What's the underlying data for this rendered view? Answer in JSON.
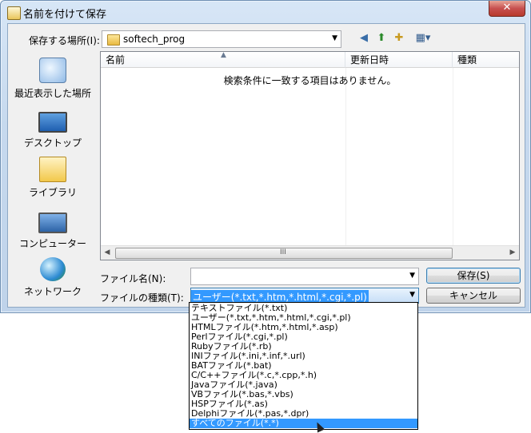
{
  "window": {
    "title": "名前を付けて保存",
    "close_label": "✕"
  },
  "toolbar": {
    "lookin_label": "保存する場所(I):",
    "lookin_value": "softech_prog",
    "back_icon": "back-icon",
    "up_icon": "up-folder-icon",
    "newfolder_icon": "new-folder-icon",
    "views_icon": "views-menu-icon"
  },
  "places": [
    {
      "label": "最近表示した場所",
      "icon": "recent-places-icon"
    },
    {
      "label": "デスクトップ",
      "icon": "desktop-icon"
    },
    {
      "label": "ライブラリ",
      "icon": "libraries-icon"
    },
    {
      "label": "コンピューター",
      "icon": "computer-icon"
    },
    {
      "label": "ネットワーク",
      "icon": "network-icon"
    }
  ],
  "filelist": {
    "columns": [
      "名前",
      "更新日時",
      "種類"
    ],
    "empty_message": "検索条件に一致する項目はありません。",
    "scroll_grip": "III"
  },
  "form": {
    "filename_label": "ファイル名(N):",
    "filename_value": "",
    "filetype_label": "ファイルの種類(T):",
    "filetype_value": "ユーザー(*.txt,*.htm,*.html,*.cgi,*.pl)",
    "save_label": "保存(S)",
    "cancel_label": "キャンセル"
  },
  "dropdown": {
    "options": [
      "テキストファイル(*.txt)",
      "ユーザー(*.txt,*.htm,*.html,*.cgi,*.pl)",
      "HTMLファイル(*.htm,*.html,*.asp)",
      "Perlファイル(*.cgi,*.pl)",
      "Rubyファイル(*.rb)",
      "INIファイル(*.ini,*.inf,*.url)",
      "BATファイル(*.bat)",
      "C/C++ファイル(*.c,*.cpp,*.h)",
      "Javaファイル(*.java)",
      "VBファイル(*.bas,*.vbs)",
      "HSPファイル(*.as)",
      "Delphiファイル(*.pas,*.dpr)",
      "すべてのファイル(*.*)"
    ],
    "selected_index": 12
  }
}
